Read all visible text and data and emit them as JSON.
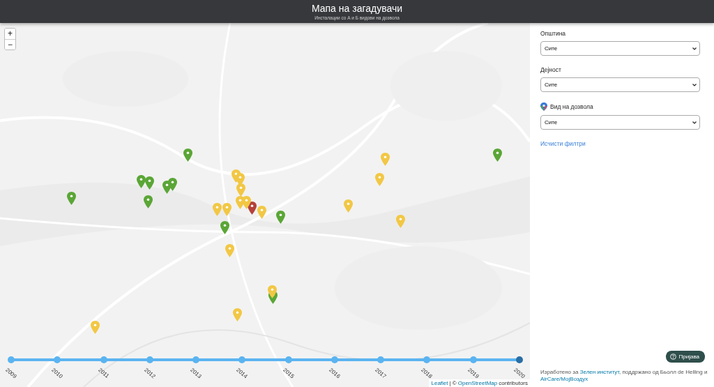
{
  "header": {
    "title": "Мапа на загадувачи",
    "subtitle": "Инсталации со А и Б видови на дозвола"
  },
  "zoom": {
    "in": "+",
    "out": "−"
  },
  "markers": [
    {
      "color": "#5aa636"
    },
    {
      "color": "#5aa636"
    },
    {
      "color": "#5aa636"
    },
    {
      "color": "#5aa636"
    },
    {
      "color": "#5aa636"
    },
    {
      "color": "#5aa636"
    },
    {
      "color": "#5aa636"
    },
    {
      "color": "#5aa636"
    },
    {
      "color": "#5aa636"
    },
    {
      "color": "#5aa636"
    },
    {
      "color": "#5aa636"
    },
    {
      "color": "#b5413a"
    },
    {
      "color": "#f2c744"
    },
    {
      "color": "#f2c744"
    },
    {
      "color": "#f2c744"
    },
    {
      "color": "#f2c744"
    },
    {
      "color": "#f2c744"
    },
    {
      "color": "#f2c744"
    },
    {
      "color": "#f2c744"
    },
    {
      "color": "#f2c744"
    },
    {
      "color": "#f2c744"
    },
    {
      "color": "#f2c744"
    },
    {
      "color": "#f2c744"
    },
    {
      "color": "#f2c744"
    },
    {
      "color": "#f2c744"
    },
    {
      "color": "#f2c744"
    },
    {
      "color": "#f2c744"
    },
    {
      "color": "#f2c744"
    }
  ],
  "timeline": [
    {
      "label": "2009",
      "selected": false
    },
    {
      "label": "2010",
      "selected": false
    },
    {
      "label": "2011",
      "selected": false
    },
    {
      "label": "2012",
      "selected": false
    },
    {
      "label": "2013",
      "selected": false
    },
    {
      "label": "2014",
      "selected": false
    },
    {
      "label": "2015",
      "selected": false
    },
    {
      "label": "2016",
      "selected": false
    },
    {
      "label": "2017",
      "selected": false
    },
    {
      "label": "2018",
      "selected": false
    },
    {
      "label": "2019",
      "selected": false
    },
    {
      "label": "2020",
      "selected": true
    }
  ],
  "attribution": {
    "leaflet": "Leaflet",
    "separator": "| ©",
    "osm": "OpenStreetMap",
    "rest": "contributors"
  },
  "filters": [
    {
      "label": "Општина",
      "value": "Сите",
      "icon": false
    },
    {
      "label": "Дејност",
      "value": "Сите",
      "icon": false
    },
    {
      "label": "Вид на дозвола",
      "value": "Сите",
      "icon": true
    }
  ],
  "clear_filters": "Исчисти филтри",
  "login": "Пријава",
  "footer": {
    "before": "Изработено за",
    "link1": "Зелен институт",
    "middle": ", поддржано од Бьолл de Helling и",
    "link2": "AirCare/МојВоздух"
  }
}
